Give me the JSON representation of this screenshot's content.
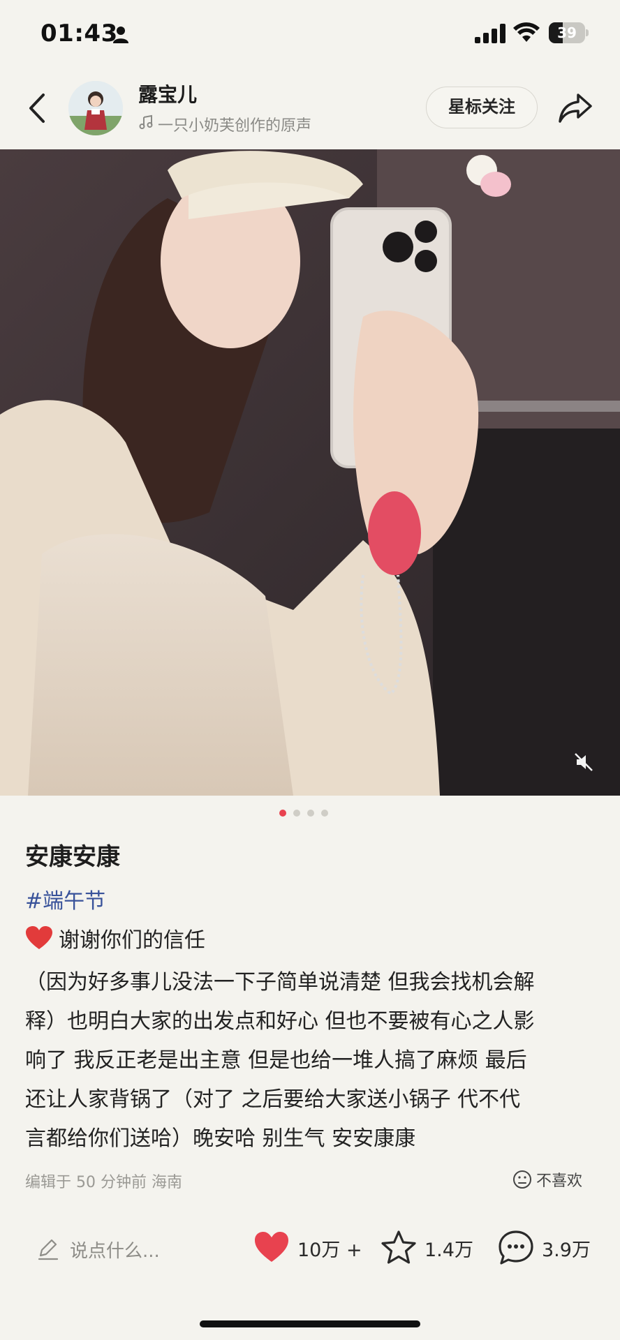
{
  "status_bar": {
    "time": "01:43",
    "battery_level": "39",
    "icons": [
      "person-icon",
      "signal-icon",
      "wifi-icon",
      "battery-icon"
    ]
  },
  "header": {
    "author_name": "露宝儿",
    "music_text": "一只小奶芙创作的原声",
    "follow_label": "星标关注",
    "icons": [
      "back-icon",
      "music-icon",
      "share-icon"
    ]
  },
  "carousel": {
    "total_images": 4,
    "active_index": 0
  },
  "post": {
    "title": "安康安康",
    "hashtag": "#端午节",
    "first_line": "谢谢你们的信任",
    "body_lines": [
      "（因为好多事儿没法一下子简单说清楚 但我会找机会解",
      "释）也明白大家的出发点和好心 但也不要被有心之人影",
      "响了 我反正老是出主意 但是也给一堆人搞了麻烦 最后",
      "还让人家背锅了（对了 之后要给大家送小锅子 代不代",
      "言都给你们送哈）晚安哈 别生气 安安康康"
    ],
    "meta": "编辑于 50 分钟前 海南",
    "dislike_label": "不喜欢"
  },
  "bottom_bar": {
    "comment_placeholder": "说点什么...",
    "likes": "10万 +",
    "favorites": "1.4万",
    "comments": "3.9万"
  },
  "colors": {
    "accent": "#e8424f",
    "hashtag": "#38529a",
    "background": "#f4f3ee"
  }
}
